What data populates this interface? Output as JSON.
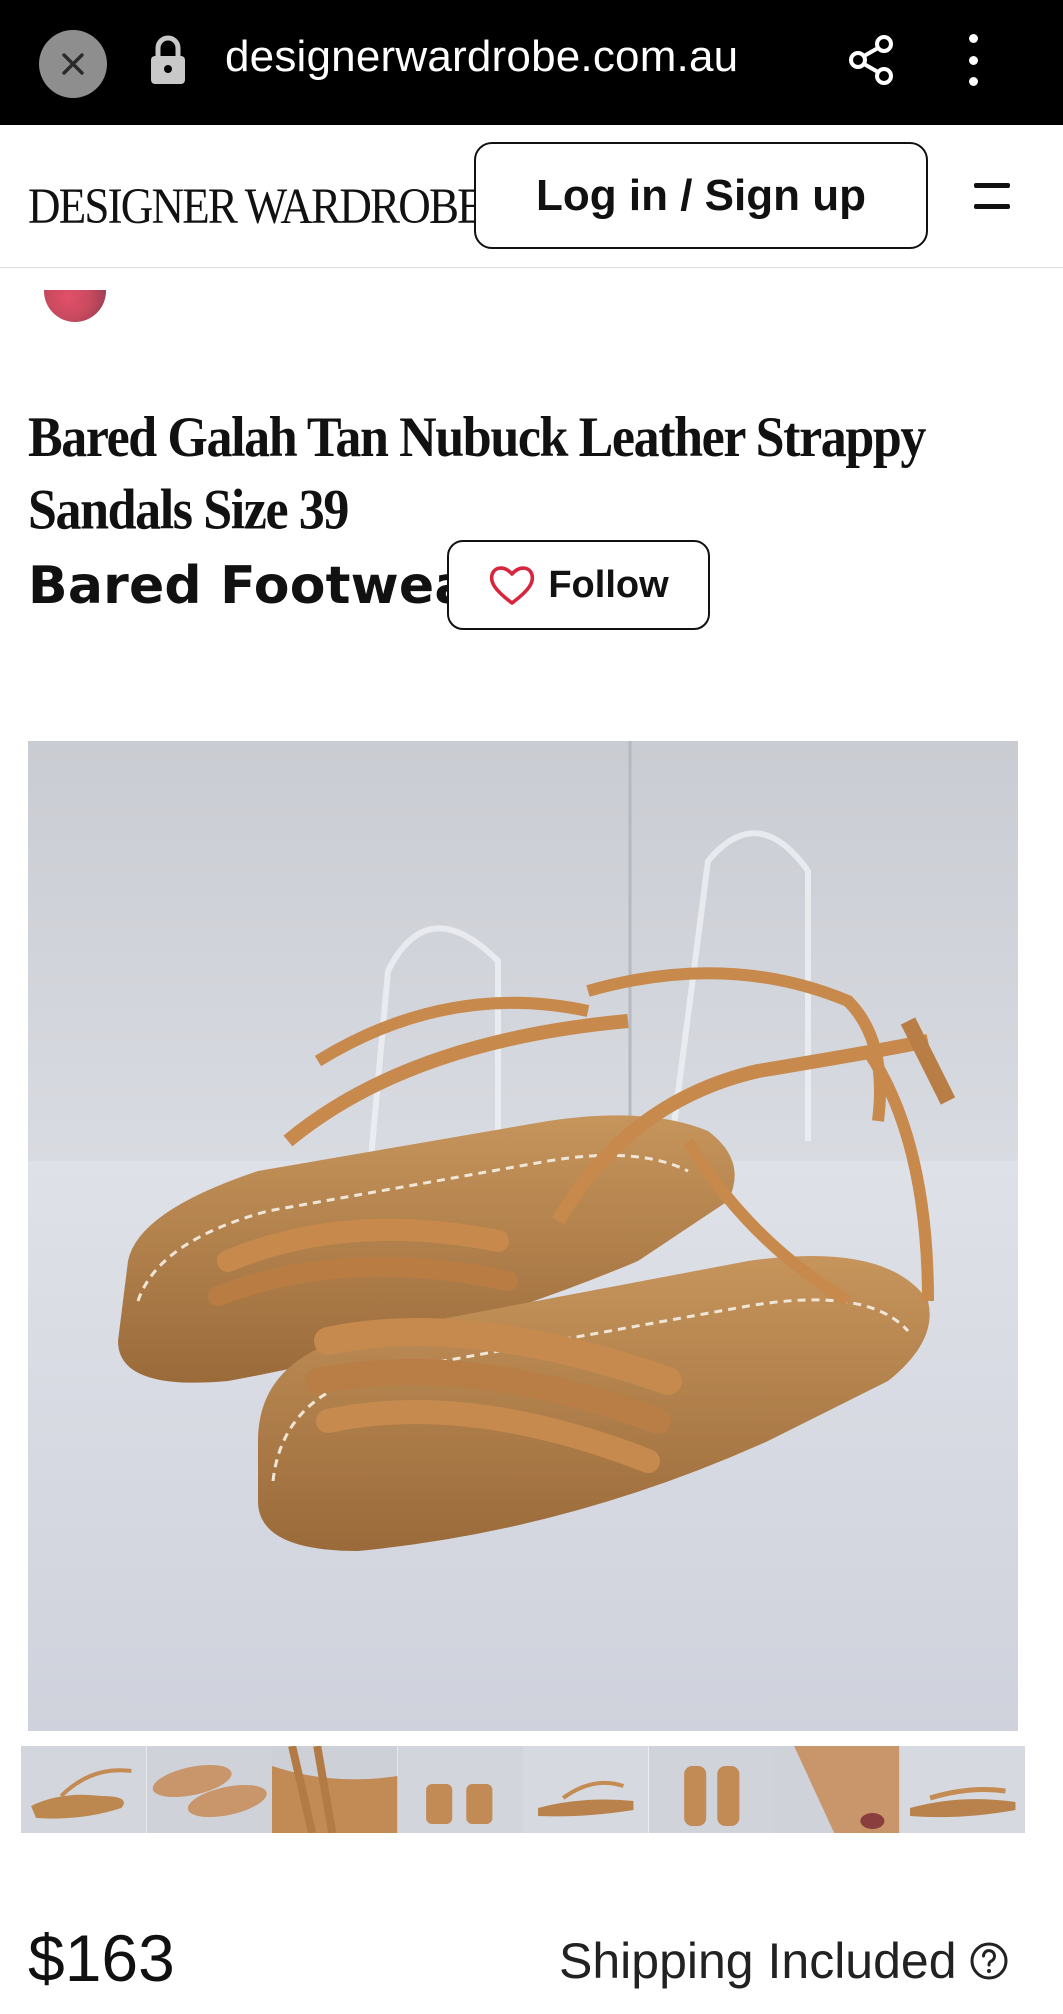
{
  "browser": {
    "url": "designerwardrobe.com.au",
    "close_icon": "close-icon",
    "lock_icon": "lock-icon",
    "share_icon": "share-icon",
    "more_icon": "more-vertical-icon"
  },
  "header": {
    "logo": "DESIGNER WARDROBE",
    "login_label": "Log in / Sign up",
    "menu_icon": "hamburger-menu-icon"
  },
  "product": {
    "title": "Bared Galah Tan Nubuck Leather Strappy Sandals Size 39",
    "brand": "Bared Footwear",
    "follow_label": "Follow",
    "follow_icon": "heart-icon",
    "thumbnails": [
      "thumbnail-1",
      "thumbnail-2",
      "thumbnail-3",
      "thumbnail-4",
      "thumbnail-5",
      "thumbnail-6",
      "thumbnail-7",
      "thumbnail-8"
    ],
    "price": "$163",
    "shipping": "Shipping Included",
    "help_icon": "question-circle-icon"
  },
  "colors": {
    "accent_heart": "#d7263d",
    "sandal_tan": "#c08a50",
    "text": "#111111"
  }
}
